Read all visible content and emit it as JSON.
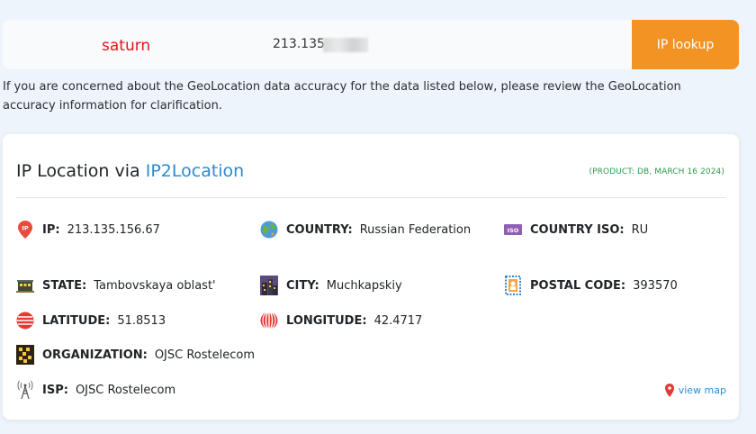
{
  "search": {
    "badge": "saturn",
    "ip_value": "213.135",
    "button_label": "IP lookup"
  },
  "notice": "If you are concerned about the GeoLocation data accuracy for the data listed below, please review the GeoLocation accuracy information for clarification.",
  "card": {
    "title_prefix": "IP Location via ",
    "title_brand": "IP2Location",
    "product": "(PRODUCT: DB, MARCH 16 2024)",
    "fields": {
      "ip": {
        "label": "IP:",
        "value": "213.135.156.67",
        "icon": "ip-pin-icon"
      },
      "country": {
        "label": "COUNTRY:",
        "value": "Russian Federation",
        "icon": "globe-icon"
      },
      "country_iso": {
        "label": "COUNTRY ISO:",
        "value": "RU",
        "icon": "iso-badge-icon"
      },
      "state": {
        "label": "STATE:",
        "value": "Tambovskaya oblast'",
        "icon": "state-building-icon"
      },
      "city": {
        "label": "CITY:",
        "value": "Muchkapskiy",
        "icon": "city-icon"
      },
      "postal_code": {
        "label": "POSTAL CODE:",
        "value": "393570",
        "icon": "postal-stamp-icon"
      },
      "latitude": {
        "label": "LATITUDE:",
        "value": "51.8513",
        "icon": "latitude-icon"
      },
      "longitude": {
        "label": "LONGITUDE:",
        "value": "42.4717",
        "icon": "longitude-icon"
      },
      "organization": {
        "label": "ORGANIZATION:",
        "value": "OJSC Rostelecom",
        "icon": "organization-icon"
      },
      "isp": {
        "label": "ISP:",
        "value": "OJSC Rostelecom",
        "icon": "antenna-icon"
      }
    },
    "view_map": "view map"
  },
  "colors": {
    "accent_button": "#f29324",
    "brand_link": "#2b8ccf",
    "product_green": "#2e9a4a",
    "badge_red": "#e8121a"
  }
}
